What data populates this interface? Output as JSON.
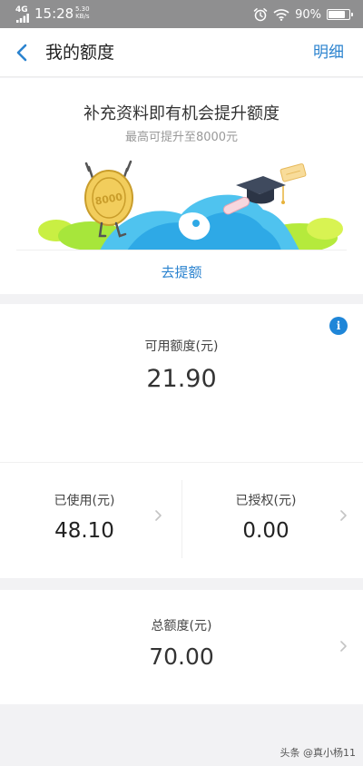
{
  "status_bar": {
    "network": "4G",
    "time": "15:28",
    "speed_value": "5.30",
    "speed_unit": "KB/s",
    "battery": "90%",
    "battery_level": 0.9
  },
  "nav": {
    "title": "我的额度",
    "detail_link": "明细"
  },
  "promo": {
    "title": "补充资料即有机会提升额度",
    "subtitle": "最高可提升至8000元",
    "coin_text": "8000",
    "action": "去提额"
  },
  "available": {
    "label": "可用额度(元)",
    "value": "21.90"
  },
  "used": {
    "label": "已使用(元)",
    "value": "48.10"
  },
  "authorized": {
    "label": "已授权(元)",
    "value": "0.00"
  },
  "total": {
    "label": "总额度(元)",
    "value": "70.00"
  },
  "watermark": "头条 @真小杨11",
  "colors": {
    "accent": "#2b83cf",
    "info_badge": "#1f86d8",
    "status_bar": "#8f8f90",
    "page_bg": "#f2f2f4"
  }
}
